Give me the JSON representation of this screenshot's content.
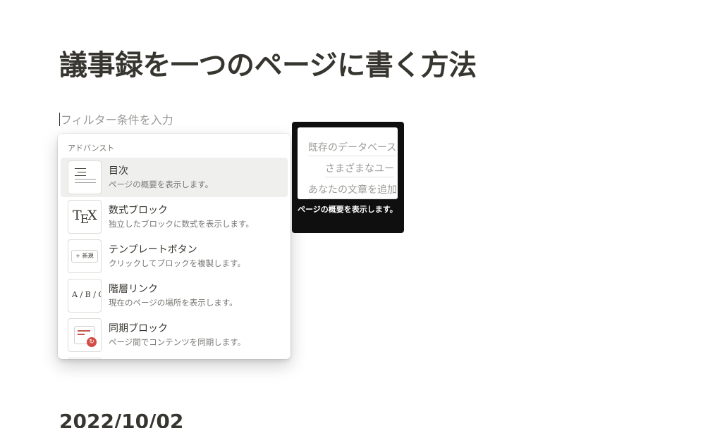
{
  "page": {
    "title": "議事録を一つのページに書く方法",
    "bottom_heading": "2022/10/02"
  },
  "filter": {
    "placeholder": "フィルター条件を入力",
    "value": ""
  },
  "menu": {
    "section_label": "アドバンスト",
    "items": [
      {
        "title": "目次",
        "description": "ページの概要を表示します。",
        "icon": "table-of-contents-icon",
        "selected": true
      },
      {
        "title": "数式ブロック",
        "description": "独立したブロックに数式を表示します。",
        "icon": "tex-icon",
        "icon_text": {
          "t": "T",
          "e": "E",
          "x": "X"
        }
      },
      {
        "title": "テンプレートボタン",
        "description": "クリックしてブロックを複製します。",
        "icon": "template-button-icon",
        "icon_text": "+ 新規"
      },
      {
        "title": "階層リンク",
        "description": "現在のページの場所を表示します。",
        "icon": "breadcrumb-icon",
        "icon_text": "A / B / C"
      },
      {
        "title": "同期ブロック",
        "description": "ページ間でコンテンツを同期します。",
        "icon": "synced-block-icon",
        "accent_color": "#d44c47"
      }
    ]
  },
  "preview": {
    "lines": [
      "既存のデータベース",
      "さまざまなユー",
      "あなたの文章を追加"
    ],
    "caption": "ページの概要を表示します。"
  }
}
